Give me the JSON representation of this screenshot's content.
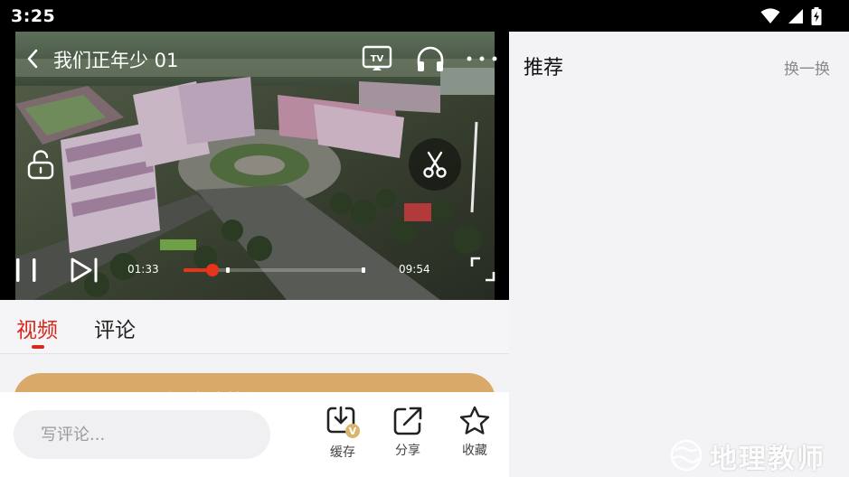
{
  "status_bar": {
    "time": "3:25",
    "icons": [
      "wifi-icon",
      "signal-icon",
      "battery-charging-icon"
    ]
  },
  "player": {
    "title": "我们正年少 01",
    "current_time": "01:33",
    "total_time": "09:54",
    "progress": 0.158,
    "icons": [
      "back-icon",
      "tv-cast-icon",
      "headphone-icon",
      "more-icon",
      "lock-icon",
      "scissors-icon",
      "pause-icon",
      "next-icon",
      "fullscreen-icon"
    ]
  },
  "tabs": [
    {
      "label": "视频",
      "active": true
    },
    {
      "label": "评论",
      "active": false
    }
  ],
  "banner": {
    "text": "开通会员畅享精彩 一元开通"
  },
  "comment_bar": {
    "placeholder": "写评论...",
    "actions": [
      {
        "label": "缓存",
        "icon": "download-icon"
      },
      {
        "label": "分享",
        "icon": "share-icon"
      },
      {
        "label": "收藏",
        "icon": "star-icon"
      }
    ]
  },
  "recommend": {
    "title": "推荐",
    "refresh_label": "换一换"
  },
  "watermark": {
    "text": "地理教师"
  },
  "colors": {
    "accent": "#d8281c",
    "banner": "#d9a96a",
    "background": "#f3f3f6"
  }
}
